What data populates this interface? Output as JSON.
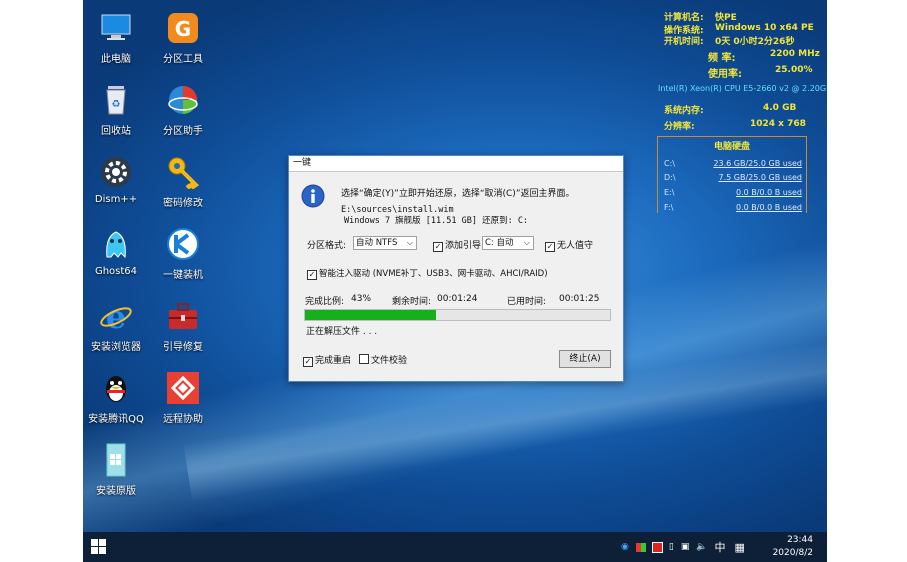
{
  "desktop": {
    "icons": [
      {
        "label": "此电脑"
      },
      {
        "label": "分区工具"
      },
      {
        "label": "回收站"
      },
      {
        "label": "分区助手"
      },
      {
        "label": "Dism++"
      },
      {
        "label": "密码修改"
      },
      {
        "label": "Ghost64"
      },
      {
        "label": "一键装机"
      },
      {
        "label": "安装浏览器"
      },
      {
        "label": "引导修复"
      },
      {
        "label": "安装腾讯QQ"
      },
      {
        "label": "远程协助"
      },
      {
        "label": "安装原版"
      }
    ]
  },
  "sysinfo": {
    "computer_name_label": "计算机名:",
    "computer_name": "快PE",
    "os_label": "操作系统:",
    "os": "Windows 10 x64 PE",
    "uptime_label": "开机时间:",
    "uptime": "0天 0小时2分26秒",
    "freq_label": "频    率:",
    "freq": "2200 MHz",
    "usage_label": "使用率:",
    "usage": "25.00%",
    "cpu": "Intel(R) Xeon(R) CPU E5-2660 v2 @ 2.20GHz",
    "mem_label": "系统内存:",
    "mem": "4.0 GB",
    "res_label": "分辨率:",
    "res": "1024 x 768",
    "hdd_title": "电脑硬盘",
    "drives": [
      {
        "name": "C:\\",
        "usage": "23.6 GB/25.0 GB used"
      },
      {
        "name": "D:\\",
        "usage": "7.5 GB/25.0 GB used"
      },
      {
        "name": "E:\\",
        "usage": "0.0 B/0.0 B used"
      },
      {
        "name": "F:\\",
        "usage": "0.0 B/0.0 B used"
      }
    ]
  },
  "dialog": {
    "title": "一键",
    "prompt": "选择“确定(Y)”立即开始还原，选择“取消(C)”返回主界面。",
    "path": "E:\\sources\\install.wim",
    "image_desc": "Windows 7 旗舰版 [11.51 GB]  还原到: C:",
    "format_label": "分区格式:",
    "format_value": "自动 NTFS",
    "add_boot_label": "添加引导",
    "boot_value": "C: 自动",
    "unattended_label": "无人值守",
    "drivers_label": "智能注入驱动 (NVME补丁、USB3、网卡驱动、AHCI/RAID)",
    "progress_label": "完成比例:",
    "progress_value": "43%",
    "progress_fraction": 0.43,
    "remaining_label": "剩余时间:",
    "remaining_value": "00:01:24",
    "elapsed_label": "已用时间:",
    "elapsed_value": "00:01:25",
    "status": "正在解压文件 . . .",
    "restart_label": "完成重启",
    "verify_label": "文件校验",
    "stop_button": "终止(A)"
  },
  "taskbar": {
    "ime": "中",
    "time": "23:44",
    "date": "2020/8/2"
  }
}
